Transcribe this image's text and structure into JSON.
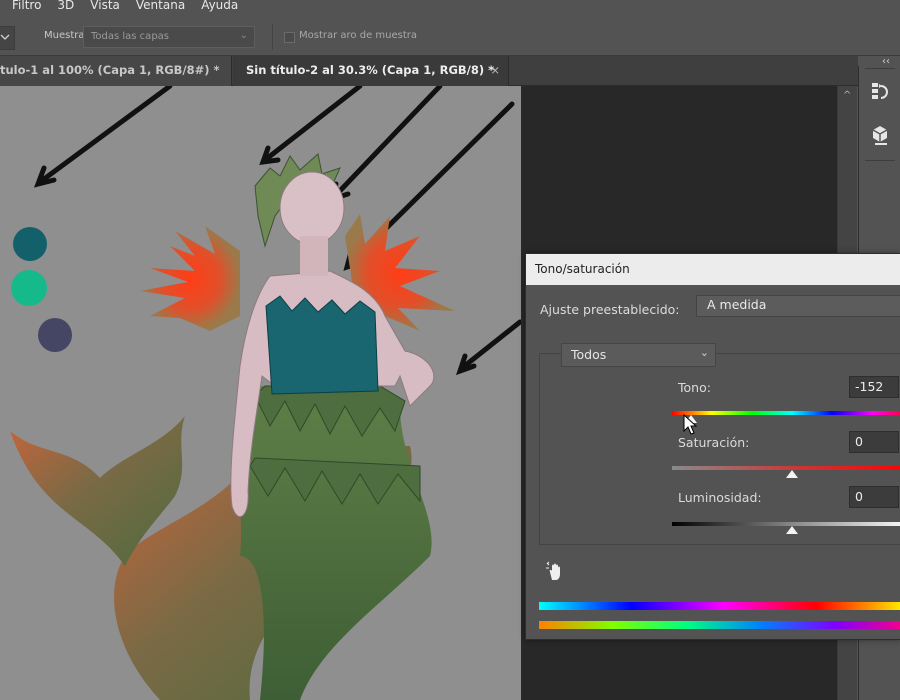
{
  "menu": [
    "Filtro",
    "3D",
    "Vista",
    "Ventana",
    "Ayuda"
  ],
  "options": {
    "sample_label": "Muestra:",
    "sample_value": "Todas las capas",
    "show_ring_label": "Mostrar aro de muestra",
    "show_ring_checked": false
  },
  "tabs": [
    {
      "label": "tulo-1 al 100% (Capa 1, RGB/8#) *",
      "active": false
    },
    {
      "label": "Sin título-2 al 30.3% (Capa 1, RGB/8) *",
      "active": true
    }
  ],
  "canvas": {
    "swatch_colors": [
      "#13606b",
      "#16b98a",
      "#454663"
    ]
  },
  "dialog": {
    "title": "Tono/saturación",
    "preset_label": "Ajuste preestablecido:",
    "preset_value": "A medida",
    "channel_value": "Todos",
    "hue": {
      "label": "Tono:",
      "value": "-152",
      "level": -152
    },
    "saturation": {
      "label": "Saturación:",
      "value": "0",
      "level": 0
    },
    "lightness": {
      "label": "Luminosidad:",
      "value": "0",
      "level": 0
    }
  },
  "icons": {
    "close_tab": "×",
    "chevron_down": "⌄",
    "collapse_panels": "‹‹",
    "scroll_up": "^"
  }
}
